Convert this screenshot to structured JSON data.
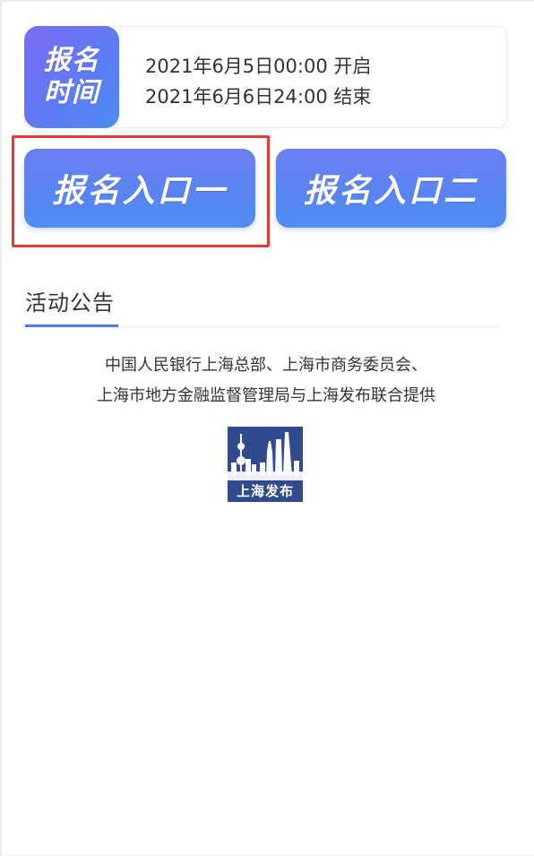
{
  "registration_time": {
    "badge_line1": "报名",
    "badge_line2": "时间",
    "start": "2021年6月5日00:00 开启",
    "end": "2021年6月6日24:00 结束"
  },
  "entries": {
    "entry1_label": "报名入口一",
    "entry2_label": "报名入口二"
  },
  "announcement": {
    "title": "活动公告",
    "line1": "中国人民银行上海总部、上海市商务委员会、",
    "line2": "上海市地方金融监督管理局与上海发布联合提供",
    "logo_text": "上海发布"
  },
  "colors": {
    "accent": "#5a84f3",
    "highlight": "#e53935",
    "logo_bg": "#2f4a8e"
  }
}
